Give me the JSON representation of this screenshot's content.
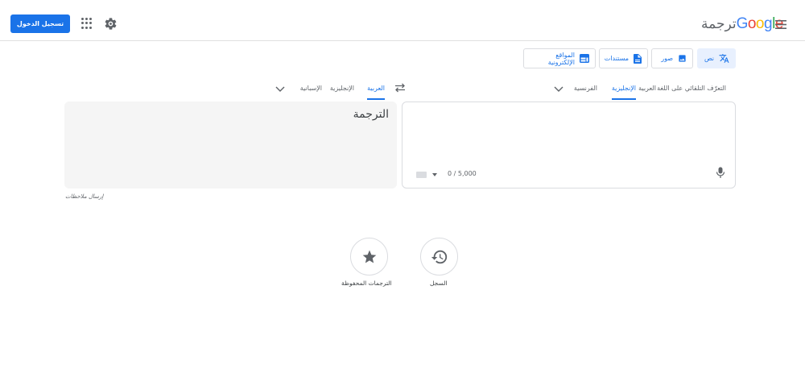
{
  "header": {
    "signin_label": "تسجيل الدخول",
    "logo_word": "Google",
    "logo_suffix": "ترجمة",
    "logo_colors": [
      "#4285f4",
      "#ea4335",
      "#fbbc05",
      "#4285f4",
      "#34a853",
      "#ea4335"
    ]
  },
  "modes": [
    {
      "label": "نص",
      "icon": "translate-icon",
      "active": true
    },
    {
      "label": "صور",
      "icon": "image-icon",
      "active": false
    },
    {
      "label": "مستندات",
      "icon": "document-icon",
      "active": false
    },
    {
      "label": "المواقع الإلكترونية",
      "icon": "web-icon",
      "active": false
    }
  ],
  "source_langs": {
    "detect": "التعرّف التلقائي على اللغة",
    "items": [
      "العربية",
      "الإنجليزية",
      "الفرنسية"
    ],
    "selected": "الإنجليزية"
  },
  "target_langs": {
    "items": [
      "العربية",
      "الإنجليزية",
      "الإسبانية"
    ],
    "selected": "العربية"
  },
  "source": {
    "counter": "0 / 5,000"
  },
  "target": {
    "placeholder": "الترجمة"
  },
  "feedback": "إرسال ملاحظات",
  "bottom": {
    "history_label": "السجل",
    "saved_label": "الترجمات المحفوظة"
  },
  "colors": {
    "accent": "#1a73e8",
    "active_tab_bg": "#e8f0fe",
    "target_bg": "#f5f5f5"
  }
}
